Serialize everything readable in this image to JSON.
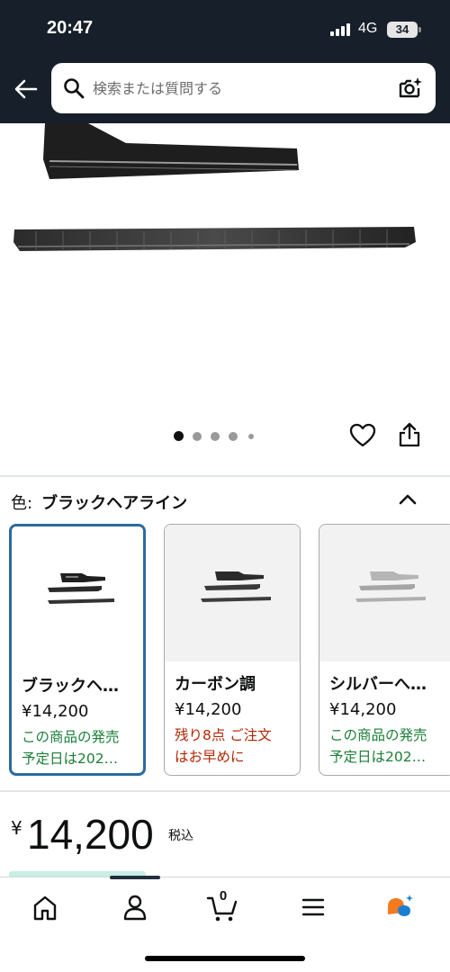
{
  "status_bar": {
    "time": "20:47",
    "network": "4G",
    "battery": "34"
  },
  "header": {
    "back_icon": "back-arrow-icon",
    "search_placeholder": "検索または質問する",
    "search_icon": "search-icon",
    "camera_icon": "camera-search-icon"
  },
  "gallery": {
    "image_count": 5,
    "active_index": 0,
    "like_icon": "heart-icon",
    "share_icon": "share-icon"
  },
  "color_selector": {
    "label": "色:",
    "value": "ブラックヘアライン",
    "toggle_icon": "chevron-up-icon"
  },
  "variants": [
    {
      "name": "ブラックヘ…",
      "price": "¥14,200",
      "availability_line1": "この商品の発売",
      "availability_line2": "予定日は202…",
      "availability_color": "#1a7f37",
      "selected": true
    },
    {
      "name": "カーボン調",
      "price": "¥14,200",
      "availability_line1": "残り8点 ご注文",
      "availability_line2": "はお早めに",
      "availability_color": "#b12704",
      "selected": false
    },
    {
      "name": "シルバーへ…",
      "price": "¥14,200",
      "availability_line1": "この商品の発売",
      "availability_line2": "予定日は202…",
      "availability_color": "#1a7f37",
      "selected": false
    }
  ],
  "price": {
    "currency": "¥",
    "amount": "14,200",
    "tax_note": "税込"
  },
  "bottom_nav": {
    "items": [
      "home-icon",
      "account-icon",
      "cart-icon",
      "menu-icon",
      "ai-assistant-icon"
    ],
    "cart_count": "0"
  },
  "colors": {
    "header_bg": "#17202a",
    "selected_border": "#2b6aa0",
    "in_stock_green": "#1a7f37",
    "low_stock_red": "#b12704"
  }
}
